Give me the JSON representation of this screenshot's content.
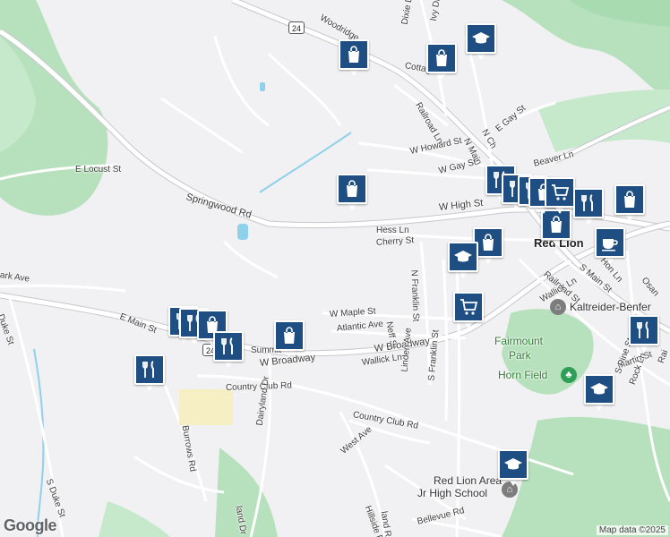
{
  "map": {
    "attribution": "Map data ©2025",
    "logo": "Google",
    "town_label": "Red Lion",
    "route_shield": "24",
    "colors": {
      "marker": "#1f4f82",
      "park": "#b7e1bd",
      "water": "#8fd0ec",
      "road": "#ffffff",
      "background": "#f1f1f3"
    }
  },
  "streets": [
    "Woodridge",
    "Dixie Dr",
    "Ivy Dr",
    "Cottage",
    "Railroad Ln",
    "N Main",
    "N Ch",
    "E Gay St",
    "W Howard St",
    "W Gay St",
    "Beaver Ln",
    "E Locust St",
    "Springwood Rd",
    "W High St",
    "Hess Ln",
    "Cherry St",
    "N Franklin St",
    "W Maple St",
    "Atlantic Ave",
    "Neff St",
    "Summit",
    "W Broadway",
    "Wallick Ln",
    "Country Club Rd",
    "Dairyland Dr",
    "Linden Ave",
    "S Franklin St",
    "West Ave",
    "Burrows Rd",
    "S Duke St",
    "Duke St",
    "E Main St",
    "ark Ave",
    "Railroad St",
    "S Main St",
    "Wallick Ln",
    "Martin St",
    "S Pine St",
    "Rock Ln",
    "Hillside Dr",
    "Bellevue Rd",
    "land Rd",
    "land Dr",
    "Osan",
    "Hon Ln",
    "Rai"
  ],
  "places": {
    "kaltreider": "Kaltreider-Benfer",
    "fairmount": "Fairmount",
    "fairmount2": "Park",
    "horn_field": "Horn Field",
    "school": "Red Lion Area",
    "school2": "Jr High School"
  },
  "markers": [
    {
      "icon": "school-icon"
    },
    {
      "icon": "shopping-bag-icon"
    },
    {
      "icon": "shopping-bag-icon"
    },
    {
      "icon": "shopping-bag-icon"
    },
    {
      "icon": "shopping-bag-icon"
    },
    {
      "icon": "shopping-bag-icon"
    },
    {
      "icon": "shopping-bag-icon"
    },
    {
      "icon": "shopping-cart-icon"
    },
    {
      "icon": "restaurant-icon"
    },
    {
      "icon": "restaurant-icon"
    },
    {
      "icon": "restaurant-icon"
    },
    {
      "icon": "shopping-bag-icon"
    },
    {
      "icon": "coffee-icon"
    },
    {
      "icon": "school-icon"
    },
    {
      "icon": "shopping-cart-icon"
    },
    {
      "icon": "shopping-bag-icon"
    },
    {
      "icon": "restaurant-icon"
    },
    {
      "icon": "restaurant-icon"
    },
    {
      "icon": "restaurant-icon"
    },
    {
      "icon": "shopping-bag-icon"
    },
    {
      "icon": "restaurant-icon"
    },
    {
      "icon": "restaurant-icon"
    },
    {
      "icon": "school-icon"
    },
    {
      "icon": "restaurant-icon"
    },
    {
      "icon": "school-icon"
    }
  ]
}
